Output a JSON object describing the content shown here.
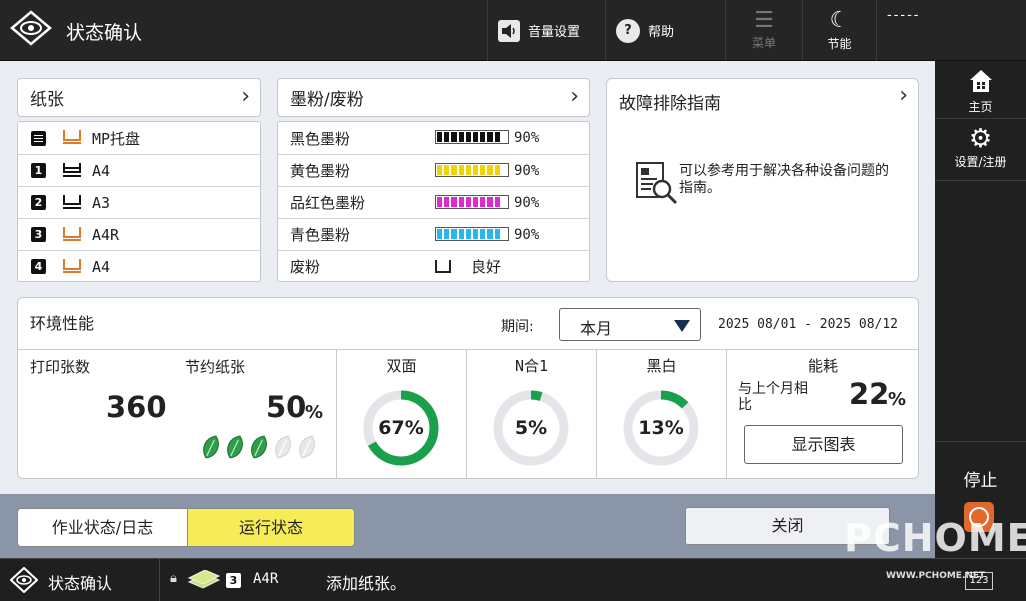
{
  "topbar": {
    "title": "状态确认",
    "volume_label": "音量设置",
    "help_label": "帮助",
    "menu_label": "菜单",
    "energy_label": "节能",
    "user_label": "-----"
  },
  "paper": {
    "title": "纸张",
    "rows": [
      {
        "slot": "mp",
        "label": "MP托盘"
      },
      {
        "slot": "1",
        "label": "A4"
      },
      {
        "slot": "2",
        "label": "A3"
      },
      {
        "slot": "3",
        "label": "A4R"
      },
      {
        "slot": "4",
        "label": "A4"
      }
    ]
  },
  "toner": {
    "title": "墨粉/废粉",
    "rows": [
      {
        "name": "黑色墨粉",
        "pct": "90%",
        "level": 0.9,
        "color": "#111111"
      },
      {
        "name": "黄色墨粉",
        "pct": "90%",
        "level": 0.9,
        "color": "#f2d400"
      },
      {
        "name": "品红色墨粉",
        "pct": "90%",
        "level": 0.9,
        "color": "#e02ad0"
      },
      {
        "name": "青色墨粉",
        "pct": "90%",
        "level": 0.9,
        "color": "#29b6ea"
      }
    ],
    "waste": {
      "name": "废粉",
      "status": "良好"
    }
  },
  "troubleshoot": {
    "title": "故障排除指南",
    "text": "可以参考用于解决各种设备问题的指南。"
  },
  "env": {
    "title": "环境性能",
    "period_label": "期间:",
    "period_value": "本月",
    "date_range": "2025 08/01 - 2025 08/12",
    "print_count_label": "打印张数",
    "print_count": "360",
    "save_paper_label": "节约纸张",
    "save_paper_value": "50",
    "save_paper_unit": "%",
    "leaves_filled": 3,
    "leaves_total": 5,
    "duplex": {
      "label": "双面",
      "value": "67%",
      "level": 0.67
    },
    "nup": {
      "label": "N合1",
      "value": "5%",
      "level": 0.05
    },
    "bw": {
      "label": "黑白",
      "value": "13%",
      "level": 0.13
    },
    "energy": {
      "label": "能耗",
      "compare_label": "与上个月相比",
      "value": "22",
      "unit": "%",
      "chart_button": "显示图表"
    },
    "accent_color": "#1aa04a"
  },
  "tabs": {
    "job_log": "作业状态/日志",
    "run_status": "运行状态"
  },
  "close_label": "关闭",
  "rightbar": {
    "home": "主页",
    "settings": "设置/注册",
    "stop": "停止"
  },
  "statusbar": {
    "title": "状态确认",
    "tray_num": "3",
    "paper": "A4R",
    "message": "添加纸张。",
    "counter_box": "123"
  },
  "watermark": {
    "brand": "PCHOME",
    "url": "WWW.PCHOME.NET"
  }
}
